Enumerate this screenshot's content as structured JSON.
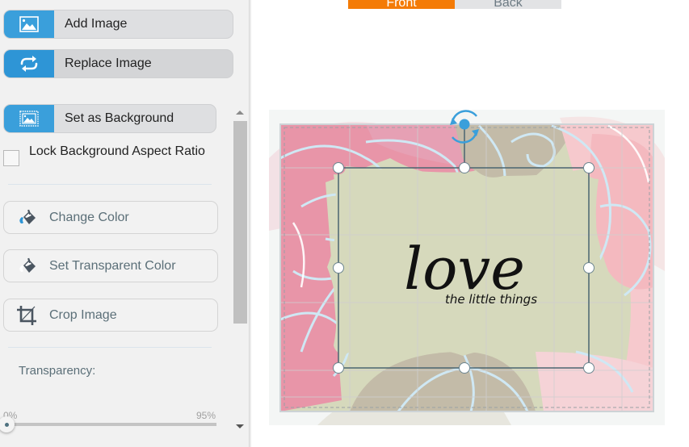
{
  "sidebar": {
    "add_image": {
      "label": "Add Image",
      "icon": "image-icon"
    },
    "replace_image": {
      "label": "Replace Image",
      "icon": "swap-arrows-icon"
    },
    "set_background": {
      "label": "Set as Background",
      "icon": "background-image-icon"
    },
    "lock_aspect": {
      "label": "Lock Background Aspect Ratio",
      "checked": false
    },
    "change_color": {
      "label": "Change Color",
      "icon": "paint-bucket-icon"
    },
    "transparent_color": {
      "label": "Set Transparent Color",
      "icon": "paint-bucket-icon"
    },
    "crop_image": {
      "label": "Crop Image",
      "icon": "crop-icon"
    },
    "transparency": {
      "label": "Transparency:",
      "min_label": "0%",
      "max_label": "95%",
      "value_percent": 0
    }
  },
  "tabs": [
    {
      "label": "Front",
      "active": true
    },
    {
      "label": "Back",
      "active": false
    }
  ],
  "design": {
    "main_text": "love",
    "sub_text": "the little things",
    "colors": {
      "pink": "#e895a8",
      "light_pink": "#f6c9cd",
      "sage": "#d6d9bc",
      "taupe": "#c3bba8",
      "outline_blue": "#cfe8f4",
      "accent": "#3a9fdb",
      "selection": "#4a6470"
    }
  }
}
